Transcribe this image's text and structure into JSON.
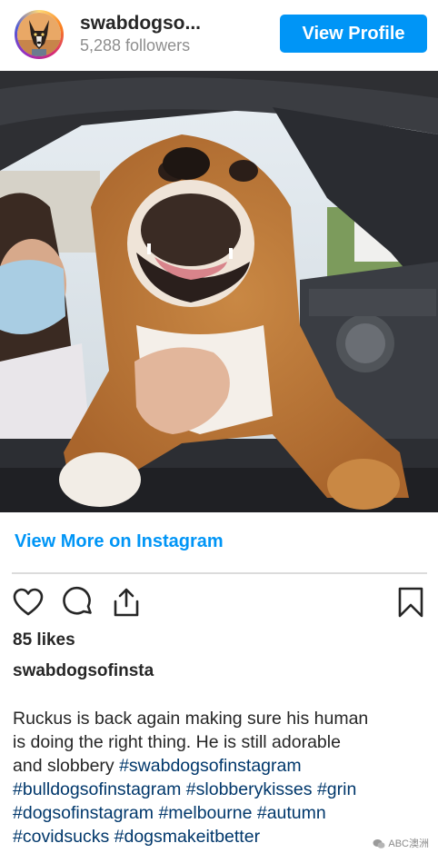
{
  "header": {
    "username": "swabdogso...",
    "followers": "5,288 followers",
    "view_profile_label": "View Profile"
  },
  "post": {
    "image_subject": "bulldog leaning out of a car window with a masked person",
    "view_more_label": "View More on Instagram",
    "icons": [
      "heart-icon",
      "comment-icon",
      "share-icon",
      "bookmark-icon"
    ],
    "likes": "85 likes",
    "caption_username": "swabdogsofinsta",
    "caption_lines": [
      {
        "text": "Ruckus is back again making sure his human",
        "tags": []
      },
      {
        "text": "is doing the right thing. He is still adorable",
        "tags": []
      },
      {
        "text": "and slobbery ",
        "tags": [
          "#swabdogsofinstagram"
        ]
      },
      {
        "text": "",
        "tags": [
          "#bulldogsofinstagram",
          "#slobberykisses",
          "#grin"
        ]
      },
      {
        "text": "",
        "tags": [
          "#dogsofinstagram",
          "#melbourne",
          "#autumn"
        ]
      },
      {
        "text": "",
        "tags": [
          "#covidsucks",
          "#dogsmakeitbetter"
        ]
      }
    ]
  },
  "watermark": "ABC澳洲",
  "colors": {
    "accent": "#0095f6",
    "hashtag": "#00376b",
    "text": "#262626",
    "muted": "#8e8e8e",
    "divider": "#dbdbdb"
  }
}
